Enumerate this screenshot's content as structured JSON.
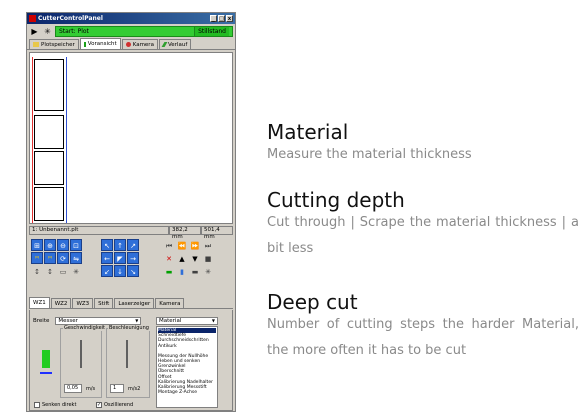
{
  "window": {
    "title": "CutterControlPanel",
    "controls": [
      "_",
      "□",
      "x"
    ]
  },
  "toolbar": {
    "play_label": "▶",
    "plot_label": "Start: Plot",
    "status": "Stillstand"
  },
  "top_tabs": [
    {
      "label": "Plotspeicher",
      "icon": "folder-icon"
    },
    {
      "label": "Voransicht",
      "icon": "preview-icon"
    },
    {
      "label": "Kamera",
      "icon": "camera-icon"
    },
    {
      "label": "Verlauf",
      "icon": "history-icon"
    }
  ],
  "status_bar": {
    "file": "1: Unbenannt.plt",
    "width": "382,2 mm",
    "height": "501,4 mm"
  },
  "bottom_tabs": [
    "WZ1",
    "WZ2",
    "WZ3",
    "Stift",
    "Laserzeiger",
    "Kamera"
  ],
  "tool_panel": {
    "breite_label": "Breite",
    "tool_select": "Messer",
    "material_select": "Material",
    "speed_group": "Geschwindigkeit",
    "accel_group": "Beschleunigung",
    "speed_value": "0,05",
    "speed_unit": "m/s",
    "accel_value": "1",
    "accel_unit": "m/s2",
    "check_senken": "Senken direkt",
    "check_oszill": "Oszillierend",
    "list_items": [
      "Material",
      "Schneidtiefe",
      "Durchschneidschritten",
      "Antikurk",
      "",
      "Messung der Nullhöhe",
      "Heben und senken",
      "Grenzwinkel",
      "Überschnitt",
      "Offset",
      "Kalibrierung Nadelhalter",
      "Kalibrierung Messstift",
      "Montage Z-Achse"
    ]
  },
  "sections": [
    {
      "heading": "Material",
      "description": "Measure the material thickness"
    },
    {
      "heading": "Cutting depth",
      "description": "Cut through | Scrape the material thickness | a bit less"
    },
    {
      "heading": "Deep cut",
      "description": "Number of cutting steps the harder Material, the more often it has to be cut"
    }
  ]
}
